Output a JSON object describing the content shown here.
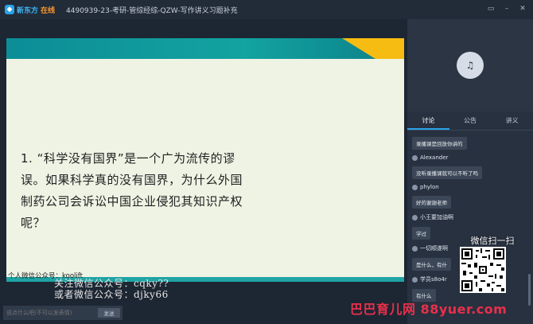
{
  "window": {
    "brand_a": "新东方",
    "brand_b": "在线",
    "title": "4490939-23-考研-管综经综-QZW-写作讲义习题补充"
  },
  "slide": {
    "question": "1. “科学没有国界”是一个广为流传的谬误。如果科学真的没有国界，为什么外国制药公司会诉讼中国企业侵犯其知识产权呢？",
    "credit": "个人微信公众号：koolift"
  },
  "watermarks": {
    "line1": "关注微信公众号：cqky??",
    "line2": "或者微信公众号：djky66",
    "qr_title": "微信扫一扫",
    "site": "巴巴育儿网 88yuer.com"
  },
  "sidebar": {
    "tabs": [
      "讨论",
      "公告",
      "讲义"
    ],
    "active_tab": "讨论",
    "messages": [
      {
        "user": "",
        "text": "录播课是回放你讲的"
      },
      {
        "user": "Alexander",
        "text": "没听录播课就可以不听了吗"
      },
      {
        "user": "phylon",
        "text": "好的谢谢老师"
      },
      {
        "user": "小王要加油啊",
        "text": "学过"
      },
      {
        "user": "一切顺遂啊",
        "text": "是什么，有什"
      },
      {
        "user": "学员s8o4r",
        "text": "有什么"
      }
    ],
    "composer_placeholder": "说点什么吧(不可以发表情)",
    "send_label": "发送"
  }
}
